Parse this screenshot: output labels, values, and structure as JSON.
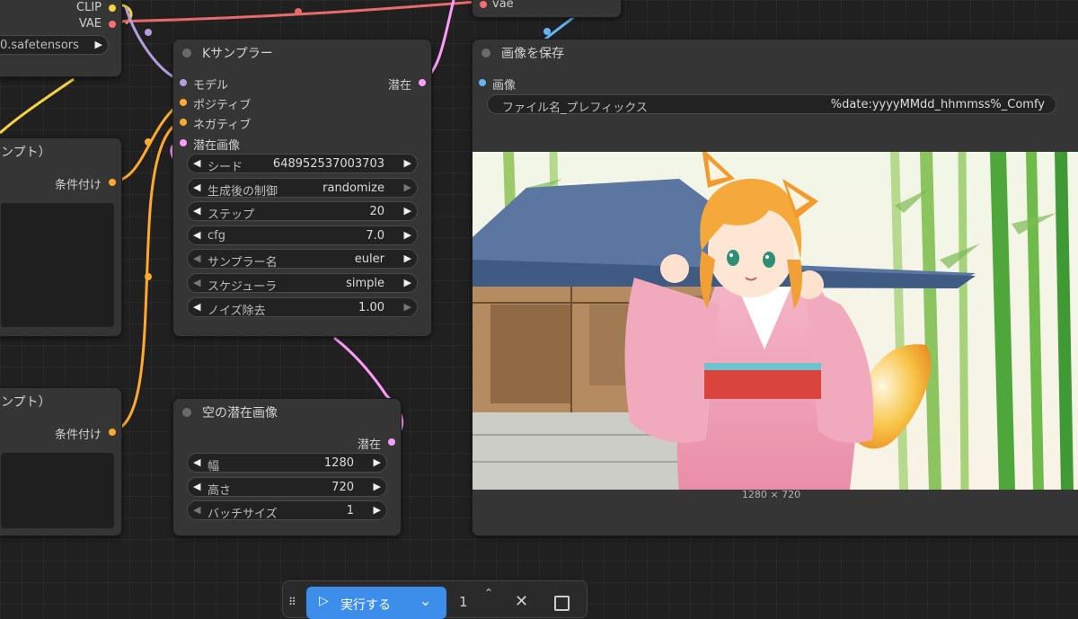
{
  "colors": {
    "clip": "#f5d442",
    "vae": "#ff6e6e",
    "model": "#b39ddb",
    "conditioning": "#ffa931",
    "latent": "#ff9cf9",
    "image": "#64b5f6",
    "run_button": "#3d8eea"
  },
  "node_top_left": {
    "clip_label": "CLIP",
    "vae_label": "VAE",
    "ckpt_value": "0.safetensors"
  },
  "node_prompt_pos": {
    "title": "ンプト）",
    "output": "条件付け"
  },
  "node_prompt_neg": {
    "title": "ンプト）",
    "output": "条件付け"
  },
  "node_vae_partial": {
    "input_label": "vae"
  },
  "ksampler": {
    "title": "Kサンプラー",
    "inputs": [
      "モデル",
      "ポジティブ",
      "ネガティブ",
      "潜在画像"
    ],
    "output": "潜在",
    "widgets": [
      {
        "label": "シード",
        "value": "648952537003703"
      },
      {
        "label": "生成後の制御",
        "value": "randomize"
      },
      {
        "label": "ステップ",
        "value": "20"
      },
      {
        "label": "cfg",
        "value": "7.0"
      },
      {
        "label": "サンプラー名",
        "value": "euler"
      },
      {
        "label": "スケジューラ",
        "value": "simple"
      },
      {
        "label": "ノイズ除去",
        "value": "1.00"
      }
    ]
  },
  "empty_latent": {
    "title": "空の潜在画像",
    "output": "潜在",
    "widgets": [
      {
        "label": "幅",
        "value": "1280"
      },
      {
        "label": "高さ",
        "value": "720"
      },
      {
        "label": "バッチサイズ",
        "value": "1"
      }
    ]
  },
  "save_image": {
    "title": "画像を保存",
    "input": "画像",
    "prefix_label": "ファイル名_プレフィックス",
    "prefix_value": "%date:yyyyMMdd_hhmmss%_Comfy",
    "image_size": "1280 × 720"
  },
  "toolbar": {
    "run_label": "実行する",
    "batch_count": "1"
  }
}
